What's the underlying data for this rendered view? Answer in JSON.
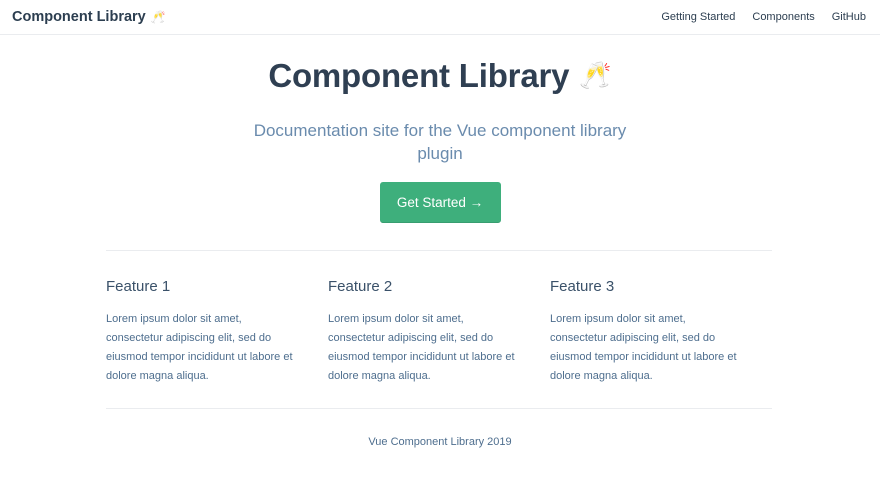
{
  "navbar": {
    "brand_title": "Component Library",
    "brand_emoji": "🥂",
    "links": [
      "Getting Started",
      "Components",
      "GitHub"
    ]
  },
  "hero": {
    "title": "Component Library",
    "emoji": "🥂",
    "description": "Documentation site for the Vue component library plugin",
    "cta_label": "Get Started →"
  },
  "features": [
    {
      "title": "Feature 1",
      "text": "Lorem ipsum dolor sit amet, consectetur adipiscing elit, sed do eiusmod tempor incididunt ut labore et dolore magna aliqua."
    },
    {
      "title": "Feature 2",
      "text": "Lorem ipsum dolor sit amet, consectetur adipiscing elit, sed do eiusmod tempor incididunt ut labore et dolore magna aliqua."
    },
    {
      "title": "Feature 3",
      "text": "Lorem ipsum dolor sit amet, consectetur adipiscing elit, sed do eiusmod tempor incididunt ut labore et dolore magna aliqua."
    }
  ],
  "footer": {
    "text": "Vue Component Library 2019"
  },
  "colors": {
    "accent": "#3eaf7c",
    "text": "#2c3e50",
    "muted": "#6a8bad"
  }
}
